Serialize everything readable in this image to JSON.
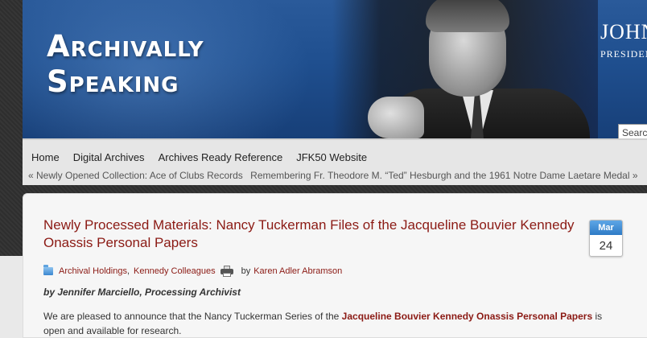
{
  "header": {
    "site_title_line1": "Archivally",
    "site_title_line2": "Speaking",
    "library_line1": "JOHN",
    "library_line2": "PRESIDENTIAL",
    "search_placeholder": "Search"
  },
  "nav": {
    "items": [
      "Home",
      "Digital Archives",
      "Archives Ready Reference",
      "JFK50 Website"
    ]
  },
  "post_nav": {
    "prev": "« Newly Opened Collection: Ace of Clubs Records",
    "next": "Remembering Fr. Theodore M. “Ted” Hesburgh and the 1961 Notre Dame Laetare Medal »"
  },
  "post": {
    "title": "Newly Processed Materials: Nancy Tuckerman Files of the Jacqueline Bouvier Kennedy Onassis Personal Papers",
    "date_month": "Mar",
    "date_day": "24",
    "categories": [
      "Archival Holdings",
      "Kennedy Colleagues"
    ],
    "author_prefix": "by",
    "author": "Karen Adler Abramson",
    "byline": "by Jennifer Marciello, Processing Archivist",
    "body_pre": "We are pleased to announce that the Nancy Tuckerman Series of the ",
    "body_link": "Jacqueline Bouvier Kennedy Onassis Personal Papers",
    "body_post": " is open and available for research."
  },
  "colors": {
    "banner": "#1f4f8f",
    "link": "#8b1a14",
    "badge_month": "#2e7bc6"
  }
}
